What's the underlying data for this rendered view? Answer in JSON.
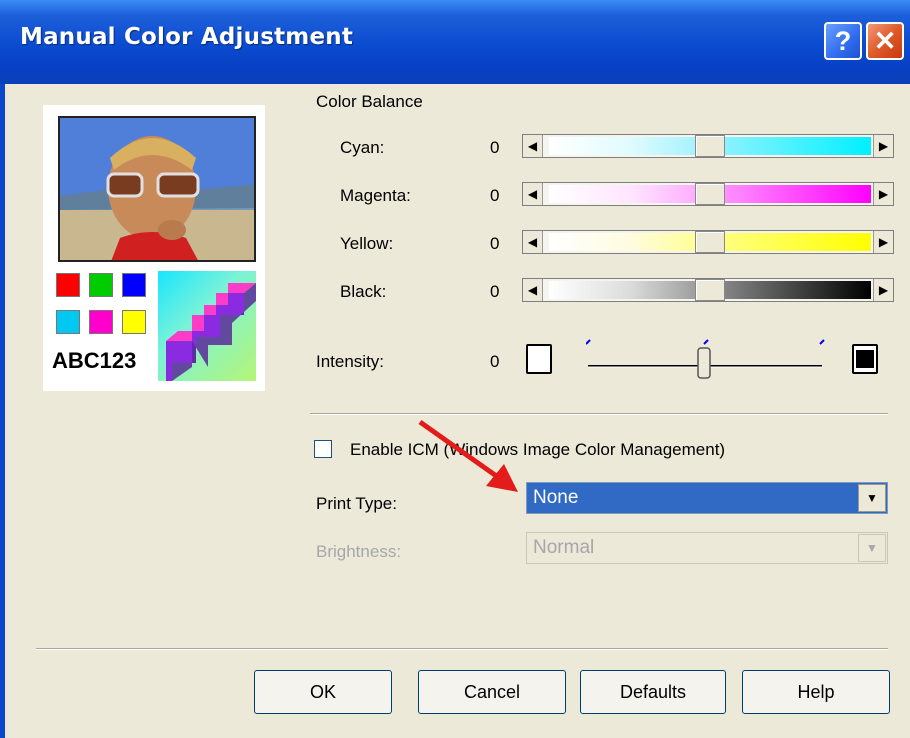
{
  "window": {
    "title": "Manual Color Adjustment",
    "help_glyph": "?",
    "close_glyph": "✕"
  },
  "preview": {
    "sample_text": "ABC123",
    "swatches": [
      "#ff0000",
      "#00cc00",
      "#0000ff",
      "#00c8f0",
      "#ff00cc",
      "#ffff00"
    ]
  },
  "color_balance": {
    "heading": "Color Balance",
    "sliders": [
      {
        "label": "Cyan:",
        "value": "0",
        "color": "#00f0ff"
      },
      {
        "label": "Magenta:",
        "value": "0",
        "color": "#ff00ff"
      },
      {
        "label": "Yellow:",
        "value": "0",
        "color": "#ffff00"
      },
      {
        "label": "Black:",
        "value": "0",
        "color": "#000000"
      }
    ],
    "left_arrow": "◀",
    "right_arrow": "▶"
  },
  "intensity": {
    "label": "Intensity:",
    "value": "0"
  },
  "icm": {
    "label": "Enable ICM (Windows Image Color Management)",
    "checked": false
  },
  "print_type": {
    "label": "Print Type:",
    "value": "None",
    "arrow": "▼"
  },
  "brightness": {
    "label": "Brightness:",
    "value": "Normal",
    "arrow": "▼"
  },
  "buttons": {
    "ok": "OK",
    "cancel": "Cancel",
    "defaults": "Defaults",
    "help": "Help"
  },
  "colors": {
    "titlebar": "#0a4bd0",
    "selection": "#316ac5",
    "dialog_bg": "#ece9d8",
    "annotation_arrow": "#e31b1b"
  }
}
